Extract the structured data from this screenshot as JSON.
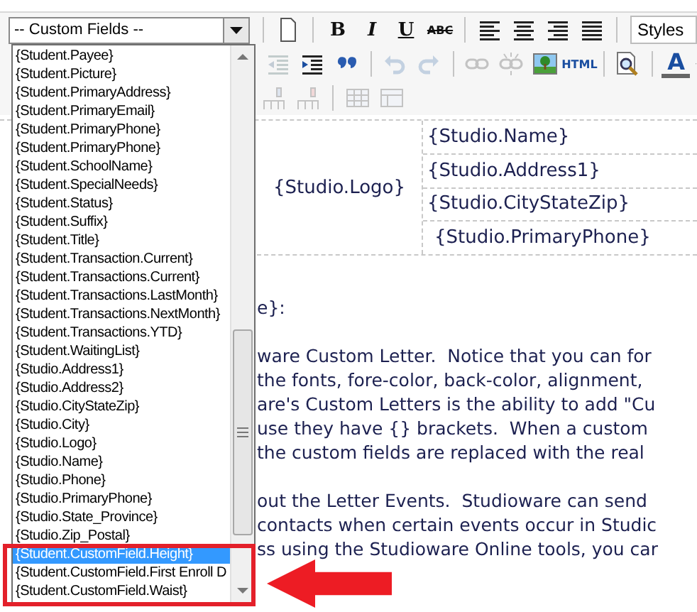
{
  "toolbar": {
    "field_select": {
      "value": "-- Custom Fields --"
    },
    "styles_select": {
      "value": "Styles"
    },
    "row_1": [
      {
        "kind": "page",
        "disabled": false
      },
      {
        "kind": "bold",
        "text": "B",
        "disabled": false
      },
      {
        "kind": "italic",
        "text": "I",
        "disabled": false
      },
      {
        "kind": "underline",
        "text": "U",
        "disabled": false
      },
      {
        "kind": "strike",
        "text": "ABC",
        "disabled": false
      },
      {
        "kind": "align-left",
        "disabled": false
      },
      {
        "kind": "align-center",
        "disabled": false
      },
      {
        "kind": "align-right",
        "disabled": false
      },
      {
        "kind": "justify",
        "disabled": false
      }
    ],
    "row_2": [
      {
        "kind": "outdent",
        "disabled": true
      },
      {
        "kind": "indent",
        "disabled": false
      },
      {
        "kind": "quote",
        "disabled": false
      },
      {
        "kind": "undo",
        "disabled": true
      },
      {
        "kind": "redo",
        "disabled": true
      },
      {
        "kind": "link",
        "disabled": true
      },
      {
        "kind": "unlink",
        "disabled": true
      },
      {
        "kind": "image",
        "disabled": false
      },
      {
        "kind": "html",
        "text": "HTML",
        "disabled": false
      },
      {
        "kind": "preview",
        "disabled": false
      },
      {
        "kind": "forecolor",
        "text": "A",
        "disabled": false
      }
    ],
    "row_3": [
      {
        "kind": "col-insert",
        "disabled": true
      },
      {
        "kind": "col-delete",
        "disabled": true
      },
      {
        "kind": "table",
        "disabled": true
      },
      {
        "kind": "cell-props",
        "disabled": true
      }
    ]
  },
  "field_list": [
    {
      "label": "{Student.Payee}",
      "selected": false
    },
    {
      "label": "{Student.Picture}",
      "selected": false
    },
    {
      "label": "{Student.PrimaryAddress}",
      "selected": false
    },
    {
      "label": "{Student.PrimaryEmail}",
      "selected": false
    },
    {
      "label": "{Student.PrimaryPhone}",
      "selected": false
    },
    {
      "label": "{Student.PrimaryPhone}",
      "selected": false
    },
    {
      "label": "{Student.SchoolName}",
      "selected": false
    },
    {
      "label": "{Student.SpecialNeeds}",
      "selected": false
    },
    {
      "label": "{Student.Status}",
      "selected": false
    },
    {
      "label": "{Student.Suffix}",
      "selected": false
    },
    {
      "label": "{Student.Title}",
      "selected": false
    },
    {
      "label": "{Student.Transaction.Current}",
      "selected": false
    },
    {
      "label": "{Student.Transactions.Current}",
      "selected": false
    },
    {
      "label": "{Student.Transactions.LastMonth}",
      "selected": false
    },
    {
      "label": "{Student.Transactions.NextMonth}",
      "selected": false
    },
    {
      "label": "{Student.Transactions.YTD}",
      "selected": false
    },
    {
      "label": "{Student.WaitingList}",
      "selected": false
    },
    {
      "label": "{Studio.Address1}",
      "selected": false
    },
    {
      "label": "{Studio.Address2}",
      "selected": false
    },
    {
      "label": "{Studio.CityStateZip}",
      "selected": false
    },
    {
      "label": "{Studio.City}",
      "selected": false
    },
    {
      "label": "{Studio.Logo}",
      "selected": false
    },
    {
      "label": "{Studio.Name}",
      "selected": false
    },
    {
      "label": "{Studio.Phone}",
      "selected": false
    },
    {
      "label": "{Studio.PrimaryPhone}",
      "selected": false
    },
    {
      "label": "{Studio.State_Province}",
      "selected": false
    },
    {
      "label": "{Studio.Zip_Postal}",
      "selected": false
    },
    {
      "label": "{Student.CustomField.Height}",
      "selected": true
    },
    {
      "label": "{Student.CustomField.First Enroll D",
      "selected": false
    },
    {
      "label": "{Student.CustomField.Waist}",
      "selected": false
    }
  ],
  "letter": {
    "header": {
      "logo": "{Studio.Logo}",
      "lines": [
        "{Studio.Name}",
        "{Studio.Address1}",
        "{Studio.CityStateZip}",
        "{Studio.PrimaryPhone}"
      ]
    },
    "greeting": "e}:",
    "paragraphs": [
      [
        "ware Custom Letter.  Notice that you can for",
        "the fonts, fore-color, back-color, alignment,",
        "are's Custom Letters is the ability to add \"Cu",
        "use they have {} brackets.  When a custom",
        "the custom fields are replaced with the real"
      ],
      [
        "out the Letter Events.  Studioware can send",
        "contacts when certain events occur in Studic",
        "ss using the Studioware Online tools, you car"
      ]
    ]
  }
}
